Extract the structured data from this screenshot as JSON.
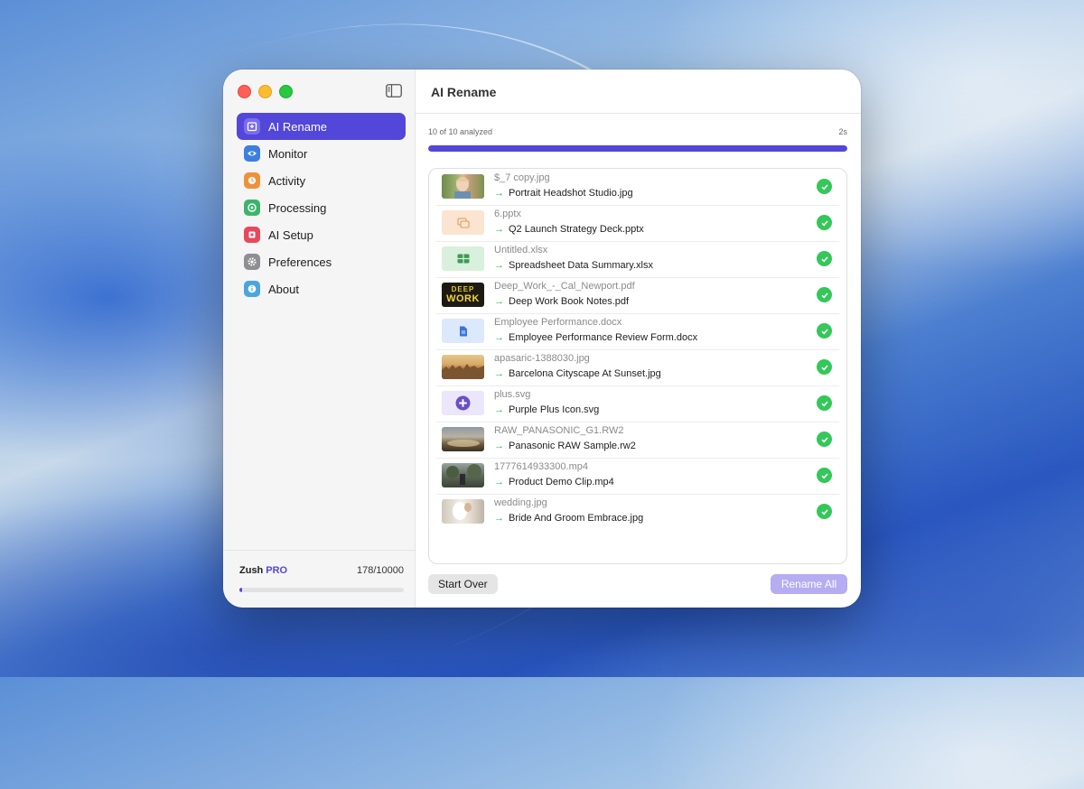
{
  "window": {
    "title": "AI Rename"
  },
  "sidebar": {
    "items": [
      {
        "label": "AI Rename",
        "icon": "ai-rename-icon",
        "color": "#7b6cf0",
        "active": true
      },
      {
        "label": "Monitor",
        "icon": "eye-icon",
        "color": "#3c7fe0",
        "active": false
      },
      {
        "label": "Activity",
        "icon": "activity-icon",
        "color": "#f0913a",
        "active": false
      },
      {
        "label": "Processing",
        "icon": "processing-icon",
        "color": "#3cb46a",
        "active": false
      },
      {
        "label": "AI Setup",
        "icon": "ai-setup-icon",
        "color": "#e8485c",
        "active": false
      },
      {
        "label": "Preferences",
        "icon": "gear-icon",
        "color": "#8e8e93",
        "active": false
      },
      {
        "label": "About",
        "icon": "info-icon",
        "color": "#4aa7de",
        "active": false
      }
    ],
    "footer": {
      "plan": "Zush",
      "plan_tier": "PRO",
      "usage": "178/10000",
      "usage_fraction": 0.0178
    }
  },
  "progress": {
    "label": "10 of 10 analyzed",
    "time": "2s",
    "fraction": 1.0
  },
  "files": [
    {
      "original": "$_7 copy.jpg",
      "renamed": "Portrait Headshot Studio.jpg",
      "thumb": "photo-portrait"
    },
    {
      "original": "6.pptx",
      "renamed": "Q2 Launch Strategy Deck.pptx",
      "thumb": "pptx-icon"
    },
    {
      "original": "Untitled.xlsx",
      "renamed": "Spreadsheet Data Summary.xlsx",
      "thumb": "xlsx-icon"
    },
    {
      "original": "Deep_Work_-_Cal_Newport.pdf",
      "renamed": "Deep Work Book Notes.pdf",
      "thumb": "book-cover"
    },
    {
      "original": "Employee Performance.docx",
      "renamed": "Employee Performance Review Form.docx",
      "thumb": "docx-icon"
    },
    {
      "original": "apasaric-1388030.jpg",
      "renamed": "Barcelona Cityscape At Sunset.jpg",
      "thumb": "photo-city"
    },
    {
      "original": "plus.svg",
      "renamed": "Purple Plus Icon.svg",
      "thumb": "plus-icon"
    },
    {
      "original": "RAW_PANASONIC_G1.RW2",
      "renamed": "Panasonic RAW Sample.rw2",
      "thumb": "photo-landscape"
    },
    {
      "original": "1777614933300.mp4",
      "renamed": "Product Demo Clip.mp4",
      "thumb": "video-frame"
    },
    {
      "original": "wedding.jpg",
      "renamed": "Bride And Groom Embrace.jpg",
      "thumb": "photo-wedding"
    }
  ],
  "buttons": {
    "start_over": "Start Over",
    "rename_all": "Rename All"
  },
  "thumb_text": {
    "book_line1": "DEEP",
    "book_line2": "WORK"
  },
  "colors": {
    "accent": "#5247d8",
    "accent_disabled": "#b5acf2",
    "success": "#34c759"
  }
}
